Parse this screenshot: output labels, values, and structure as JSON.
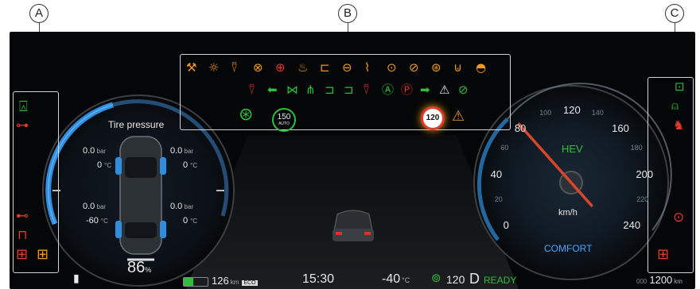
{
  "callouts": {
    "a": "A",
    "b": "B",
    "c": "C"
  },
  "left_gauge": {
    "title": "Tire pressure",
    "tires": {
      "front_left": {
        "pressure": "0.0",
        "temp": "0"
      },
      "front_right": {
        "pressure": "0.0",
        "temp": "0"
      },
      "rear_left": {
        "pressure": "0.0",
        "temp": "-60"
      },
      "rear_right": {
        "pressure": "0.0",
        "temp": "0"
      }
    },
    "pressure_unit": "bar",
    "temp_unit": "°C",
    "percent_value": "86",
    "percent_unit": "%"
  },
  "right_gauge": {
    "ticks": [
      "0",
      "20",
      "40",
      "60",
      "80",
      "100",
      "120",
      "140",
      "160",
      "180",
      "200",
      "220",
      "240"
    ],
    "mode_badge": "HEV",
    "unit": "km/h",
    "drive_mode": "COMFORT",
    "needle_speed": 80
  },
  "center_icons": {
    "speed_limit_sign": "120",
    "adaptive_limit": "150",
    "adaptive_limit_sub": "AUTO"
  },
  "status_bar": {
    "range": "126",
    "range_unit": "km",
    "range_badge": "ECO",
    "time": "15:30",
    "outside_temp": "-40",
    "outside_temp_unit": "°C",
    "cruise_speed": "120",
    "gear": "D",
    "ready": "READY",
    "odometer_prefix": "000",
    "odometer": "1200",
    "odometer_unit": "km"
  },
  "colors": {
    "amber": "#f29a1a",
    "red": "#e23b2a",
    "green": "#2fbf3a",
    "blue_arc": "#2f8ee0",
    "needle": "#d8452d"
  },
  "icons": {
    "section_b_row1": [
      "wrench-icon",
      "sun-lamp-icon",
      "seatbelt-icon",
      "esc-off-icon",
      "tpms-car-icon",
      "airbag-icon",
      "trailer-icon",
      "tpms-icon",
      "ldw-icon",
      "brake-icon",
      "lane-off-icon",
      "steering-icon",
      "tire-pressure-icon",
      "turtle-icon"
    ],
    "section_b_row2": [
      "seatbelt-red-icon",
      "turn-left-icon",
      "position-lamp-icon",
      "fog-lamp-icon",
      "low-beam-icon",
      "high-beam-icon",
      "seatbelt-green-icon",
      "auto-hold-icon",
      "parking-brake-icon",
      "turn-right-icon",
      "warning-triangle-icon",
      "no-entry-icon"
    ],
    "section_a": [
      "door-open-icon",
      "car-distance-icon",
      "car-brake-icon",
      "oil-icon",
      "battery-red-icon",
      "battery-amber-icon"
    ],
    "section_c": [
      "trailer-green-icon",
      "person-car-icon",
      "airbag-off-icon",
      "tire-warning-icon",
      "battery-icon"
    ]
  }
}
